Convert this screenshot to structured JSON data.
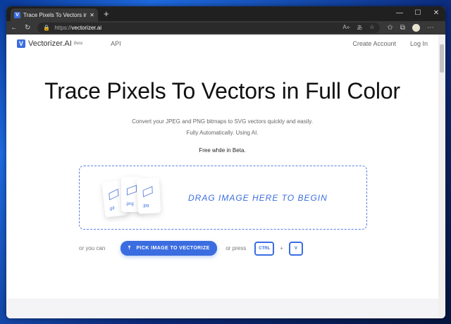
{
  "browser": {
    "tab_title": "Trace Pixels To Vectors in Full Color",
    "url_prefix": "https://",
    "url_domain": "vectorizer.ai"
  },
  "nav": {
    "brand": "Vectorizer.AI",
    "beta": "Beta",
    "api": "API",
    "create_account": "Create Account",
    "login": "Log In"
  },
  "hero": {
    "title": "Trace Pixels To Vectors in Full Color",
    "subtitle_1": "Convert your JPEG and PNG bitmaps to SVG vectors quickly and easily.",
    "subtitle_2": "Fully Automatically. Using AI.",
    "free": "Free while in Beta."
  },
  "dropzone": {
    "text": "DRAG IMAGE HERE TO BEGIN",
    "files": [
      ".gif",
      ".png",
      ".jpg"
    ]
  },
  "actions": {
    "or_you_can": "or you can",
    "pick": "PICK IMAGE TO VECTORIZE",
    "or_press": "or press",
    "ctrl": "CTRL",
    "plus": "+",
    "v": "V"
  },
  "colors": {
    "accent": "#3b6de0"
  }
}
